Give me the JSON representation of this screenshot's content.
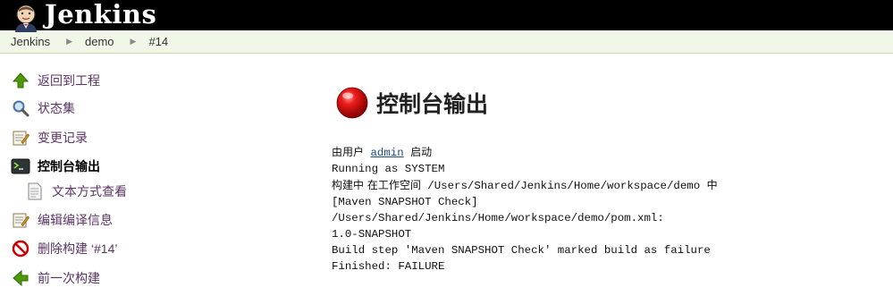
{
  "header": {
    "brand": "Jenkins",
    "logo_icon": "jenkins-butler-icon"
  },
  "breadcrumb": [
    "Jenkins",
    "demo",
    "#14"
  ],
  "sidebar": {
    "items": [
      {
        "label": "返回到工程",
        "icon": "up-arrow-icon"
      },
      {
        "label": "状态集",
        "icon": "magnifier-icon"
      },
      {
        "label": "变更记录",
        "icon": "notepad-icon"
      },
      {
        "label": "控制台输出",
        "icon": "terminal-icon",
        "active": true
      },
      {
        "label": "文本方式查看",
        "icon": "document-icon"
      },
      {
        "label": "编辑编译信息",
        "icon": "notepad-icon"
      },
      {
        "label": "删除构建 ‘#14’",
        "icon": "no-entry-icon"
      },
      {
        "label": "前一次构建",
        "icon": "left-arrow-icon"
      }
    ]
  },
  "main": {
    "title": "控制台输出",
    "status_color": "#dd0000",
    "console": {
      "line1_prefix": "由用户",
      "line1_user": "admin",
      "line1_suffix": "启动",
      "line2": "Running as SYSTEM",
      "line3_prefix": "构建中 在工作空间",
      "line3_path": "/Users/Shared/Jenkins/Home/workspace/demo",
      "line3_suffix": "中",
      "line4": "[Maven SNAPSHOT Check]",
      "line5": "/Users/Shared/Jenkins/Home/workspace/demo/pom.xml:",
      "line6": "1.0-SNAPSHOT",
      "line7": "Build step 'Maven SNAPSHOT Check' marked build as failure",
      "line8": "Finished: FAILURE"
    }
  }
}
